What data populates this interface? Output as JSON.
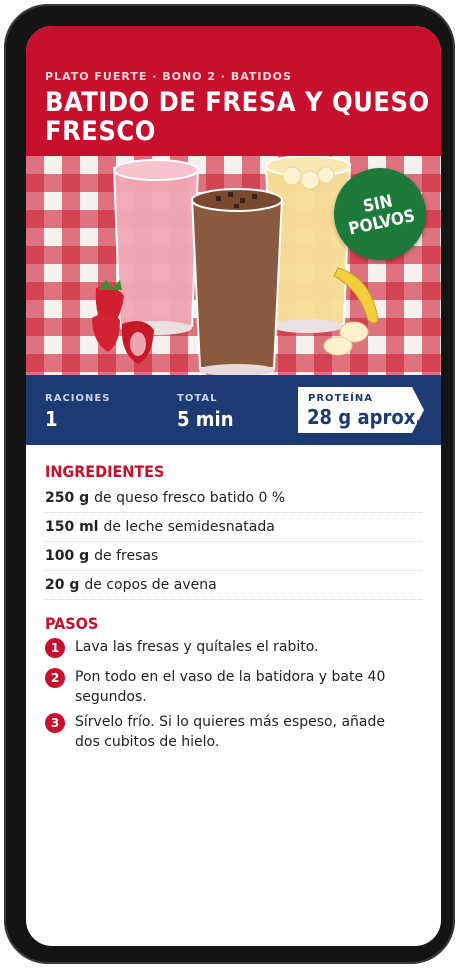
{
  "header": {
    "breadcrumb": "PLATO FUERTE · BONO 2 · BATIDOS",
    "title": "BATIDO DE FRESA Y QUESO FRESCO"
  },
  "hero": {
    "badge": "SIN POLVOS"
  },
  "stats": {
    "servings_label": "RACIONES",
    "servings_value": "1",
    "time_label": "TOTAL",
    "time_value": "5 min",
    "protein_label": "PROTEÍNA",
    "protein_value": "28 g aprox."
  },
  "ingredients": {
    "title": "INGREDIENTES",
    "items": [
      {
        "qty": "250 g",
        "text": "de queso fresco batido 0 %"
      },
      {
        "qty": "150 ml",
        "text": "de leche semidesnatada"
      },
      {
        "qty": "100 g",
        "text": "de fresas"
      },
      {
        "qty": "20 g",
        "text": "de copos de avena"
      }
    ]
  },
  "steps": {
    "title": "PASOS",
    "items": [
      {
        "num": "1",
        "text": "Lava las fresas y quítales el rabito."
      },
      {
        "num": "2",
        "text": "Pon todo en el vaso de la batidora y bate 40 segundos."
      },
      {
        "num": "3",
        "text": "Sírvelo frío. Si lo quieres más espeso, añade dos cubitos de hielo."
      }
    ]
  },
  "colors": {
    "brand_red": "#c8102e",
    "navy": "#1d3a72",
    "badge_green": "#1d7a3a"
  }
}
